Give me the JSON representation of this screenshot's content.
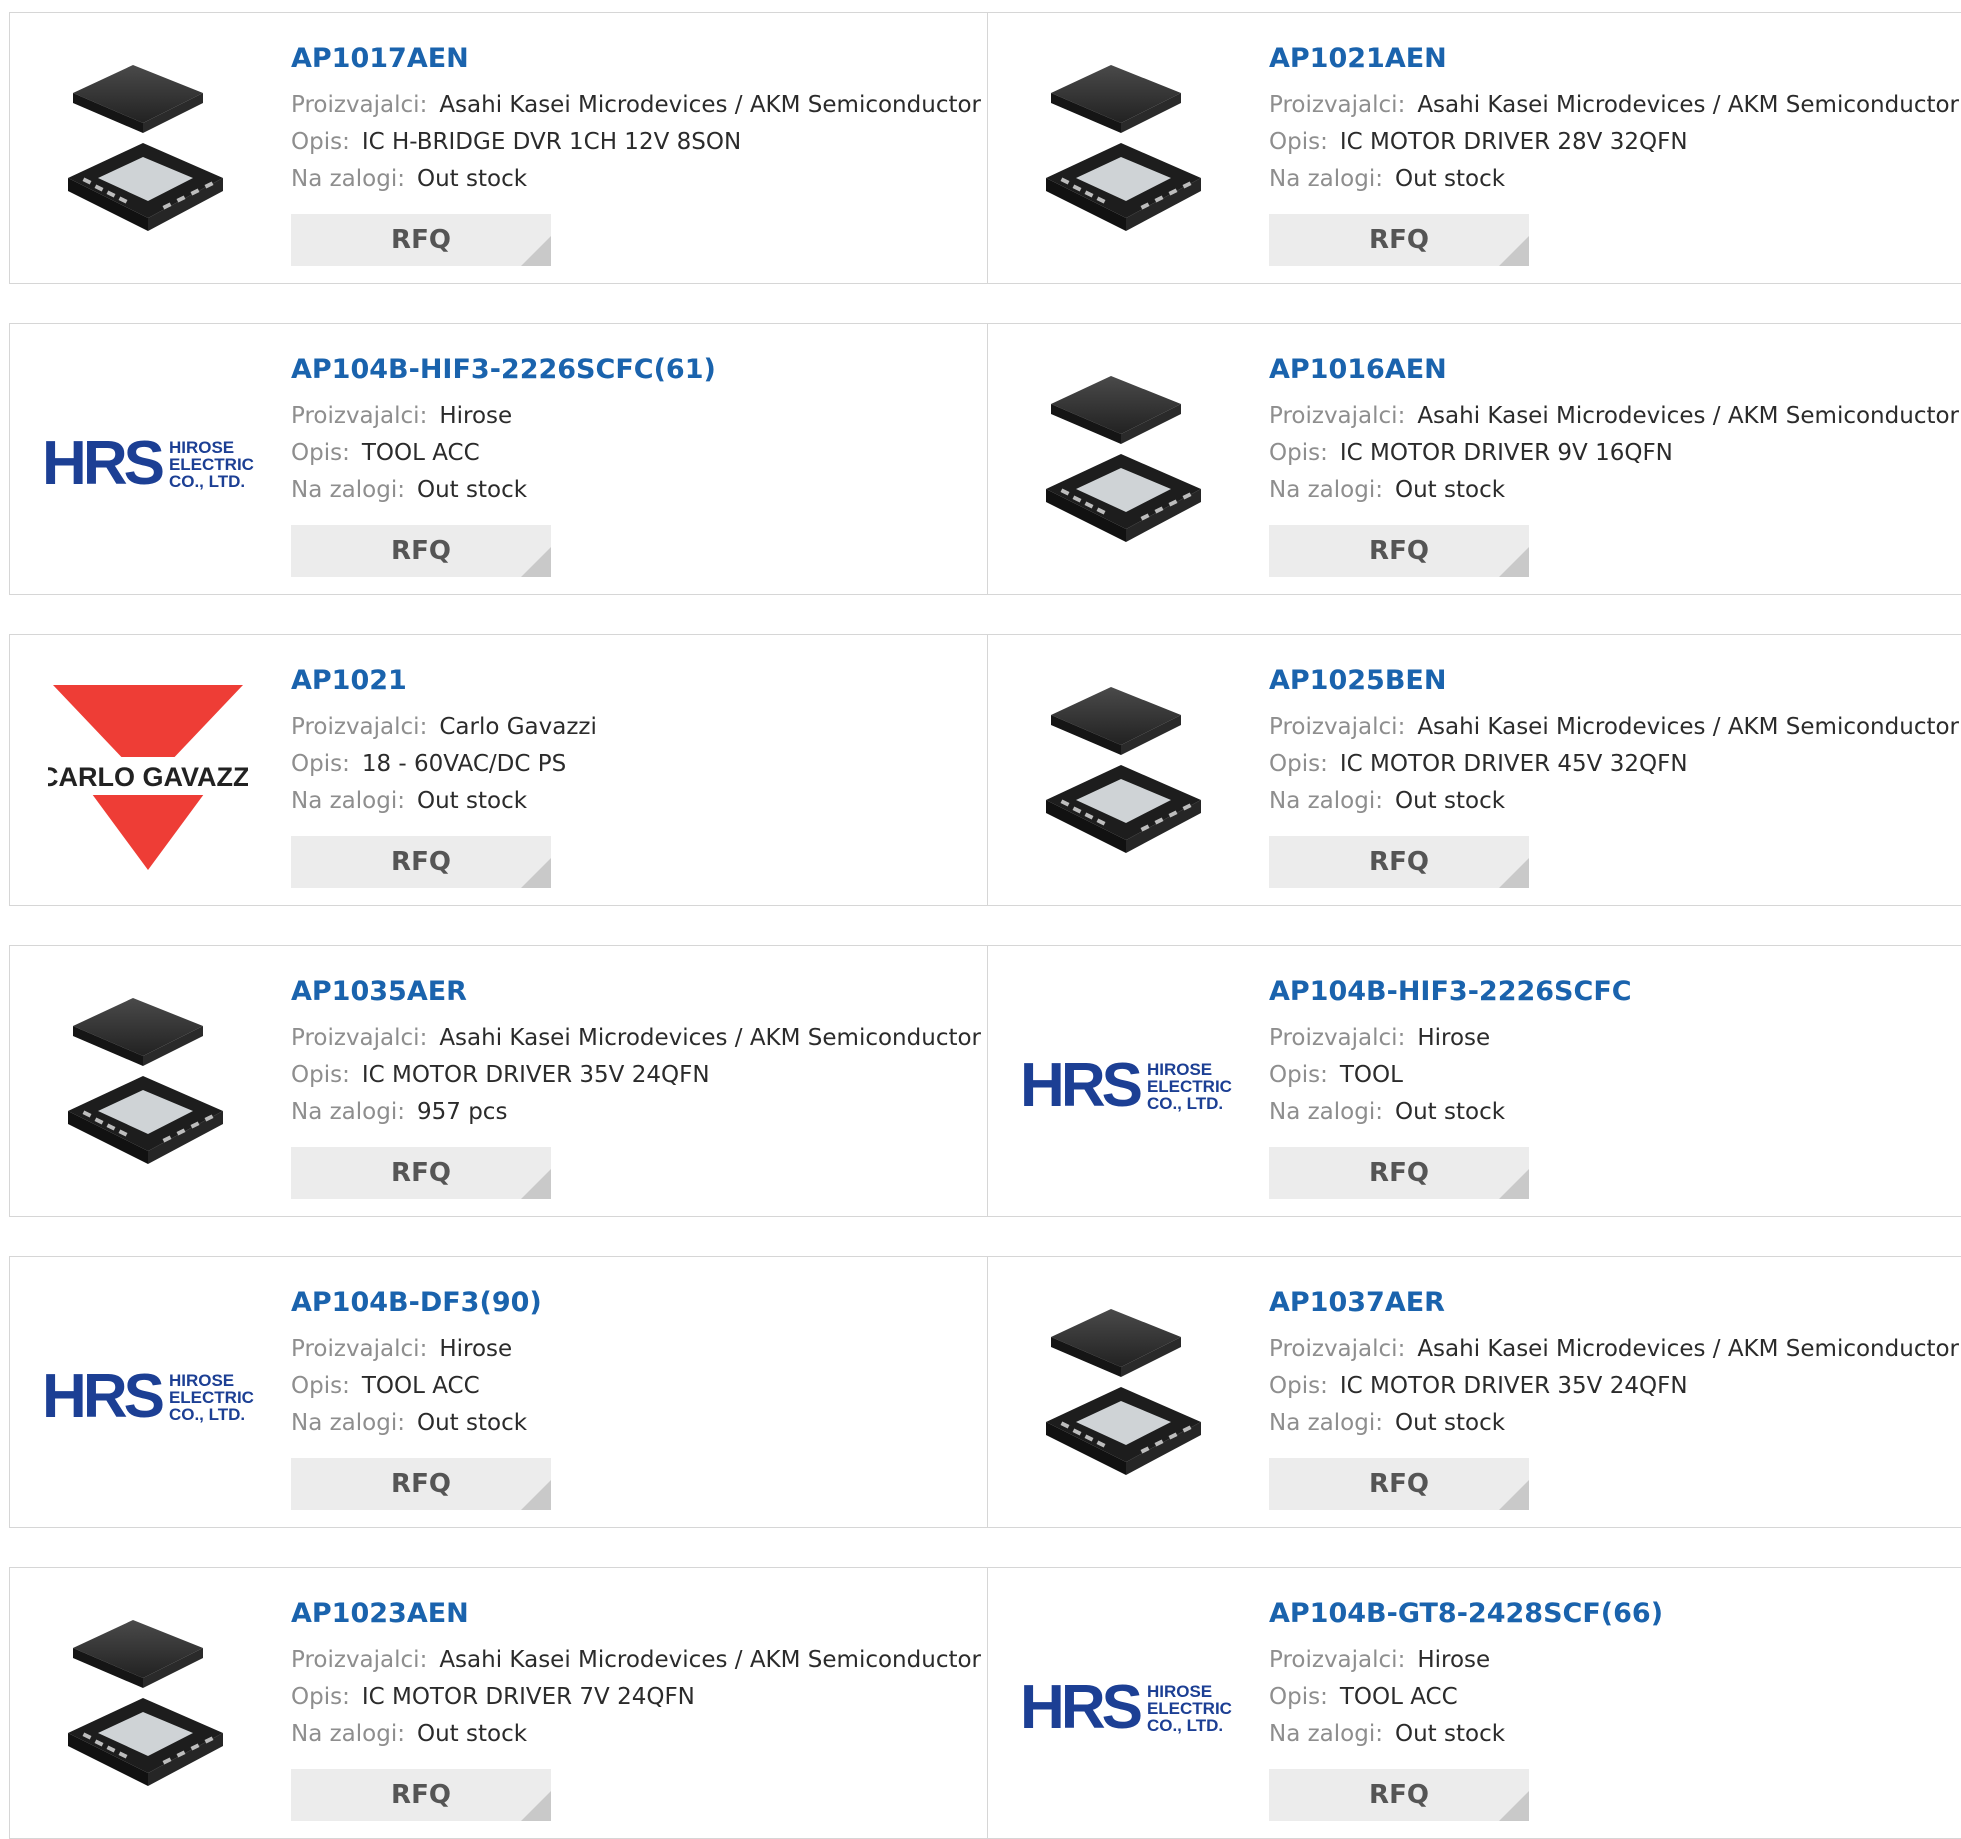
{
  "labels": {
    "manufacturer": "Proizvajalci:",
    "description": "Opis:",
    "stock": "Na zalogi:",
    "rfq": "RFQ"
  },
  "logos": {
    "hrs": {
      "mark": "HRS",
      "line1": "HIROSE",
      "line2": "ELECTRIC",
      "line3": "CO., LTD."
    },
    "carlo": {
      "text": "CARLO GAVAZZI"
    }
  },
  "colors": {
    "link": "#1a63ad",
    "hrs_blue": "#1c3f94",
    "carlo_red": "#ee3d36"
  },
  "products": [
    {
      "part": "AP1017AEN",
      "manufacturer": "Asahi Kasei Microdevices / AKM Semiconductor",
      "description": "IC H-BRIDGE DVR 1CH 12V 8SON",
      "stock": "Out stock",
      "image": "chip-8son-icon"
    },
    {
      "part": "AP1021AEN",
      "manufacturer": "Asahi Kasei Microdevices / AKM Semiconductor",
      "description": "IC MOTOR DRIVER 28V 32QFN",
      "stock": "Out stock",
      "image": "chip-qfn-icon"
    },
    {
      "part": "AP104B-HIF3-2226SCFC(61)",
      "manufacturer": "Hirose",
      "description": "TOOL ACC",
      "stock": "Out stock",
      "image": "hrs-logo"
    },
    {
      "part": "AP1016AEN",
      "manufacturer": "Asahi Kasei Microdevices / AKM Semiconductor",
      "description": "IC MOTOR DRIVER 9V 16QFN",
      "stock": "Out stock",
      "image": "chip-qfn-icon"
    },
    {
      "part": "AP1021",
      "manufacturer": "Carlo Gavazzi",
      "description": "18 - 60VAC/DC PS",
      "stock": "Out stock",
      "image": "carlo-gavazzi-logo"
    },
    {
      "part": "AP1025BEN",
      "manufacturer": "Asahi Kasei Microdevices / AKM Semiconductor",
      "description": "IC MOTOR DRIVER 45V 32QFN",
      "stock": "Out stock",
      "image": "chip-qfn-icon"
    },
    {
      "part": "AP1035AER",
      "manufacturer": "Asahi Kasei Microdevices / AKM Semiconductor",
      "description": "IC MOTOR DRIVER 35V 24QFN",
      "stock": "957 pcs",
      "image": "chip-qfn-icon"
    },
    {
      "part": "AP104B-HIF3-2226SCFC",
      "manufacturer": "Hirose",
      "description": "TOOL",
      "stock": "Out stock",
      "image": "hrs-logo"
    },
    {
      "part": "AP104B-DF3(90)",
      "manufacturer": "Hirose",
      "description": "TOOL ACC",
      "stock": "Out stock",
      "image": "hrs-logo"
    },
    {
      "part": "AP1037AER",
      "manufacturer": "Asahi Kasei Microdevices / AKM Semiconductor",
      "description": "IC MOTOR DRIVER 35V 24QFN",
      "stock": "Out stock",
      "image": "chip-qfn-icon"
    },
    {
      "part": "AP1023AEN",
      "manufacturer": "Asahi Kasei Microdevices / AKM Semiconductor",
      "description": "IC MOTOR DRIVER 7V 24QFN",
      "stock": "Out stock",
      "image": "chip-qfn-icon"
    },
    {
      "part": "AP104B-GT8-2428SCF(66)",
      "manufacturer": "Hirose",
      "description": "TOOL ACC",
      "stock": "Out stock",
      "image": "hrs-logo"
    }
  ]
}
